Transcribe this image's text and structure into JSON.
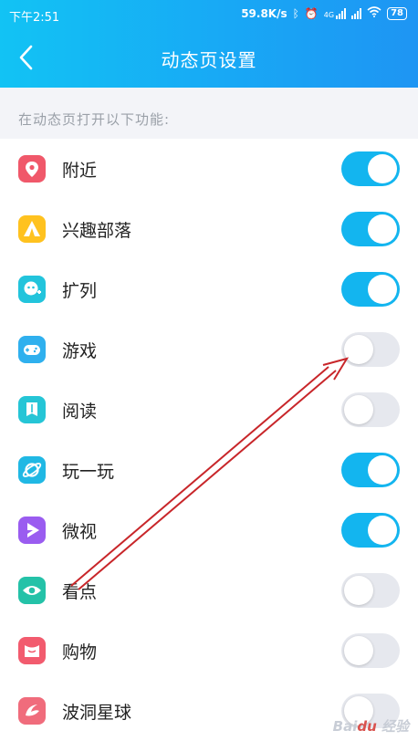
{
  "status_bar": {
    "time": "下午2:51",
    "net_speed": "59.8K/s",
    "battery": "78"
  },
  "header": {
    "title": "动态页设置"
  },
  "section": {
    "label": "在动态页打开以下功能:"
  },
  "items": [
    {
      "label": "附近",
      "icon": "location-pin-icon",
      "color": "#f0586a",
      "enabled": true
    },
    {
      "label": "兴趣部落",
      "icon": "tribe-tent-icon",
      "color": "#ffc21f",
      "enabled": true
    },
    {
      "label": "扩列",
      "icon": "make-friends-icon",
      "color": "#22c4dc",
      "enabled": true
    },
    {
      "label": "游戏",
      "icon": "gamepad-icon",
      "color": "#2fb0ee",
      "enabled": false
    },
    {
      "label": "阅读",
      "icon": "book-icon",
      "color": "#25c5d6",
      "enabled": false
    },
    {
      "label": "玩一玩",
      "icon": "planet-icon",
      "color": "#20b8e4",
      "enabled": true
    },
    {
      "label": "微视",
      "icon": "weishi-play-icon",
      "color": "#9a5cf0",
      "enabled": true
    },
    {
      "label": "看点",
      "icon": "eye-icon",
      "color": "#24c2a8",
      "enabled": false
    },
    {
      "label": "购物",
      "icon": "shopping-bag-icon",
      "color": "#f25b6e",
      "enabled": false
    },
    {
      "label": "波洞星球",
      "icon": "bodong-icon",
      "color": "#f06c7c",
      "enabled": false
    }
  ],
  "colors": {
    "accent": "#13b5ef",
    "header_gradient_start": "#12c3f4",
    "header_gradient_end": "#1e95f3",
    "annotation_arrow": "#c8262a"
  },
  "watermark": "Baidu经验"
}
